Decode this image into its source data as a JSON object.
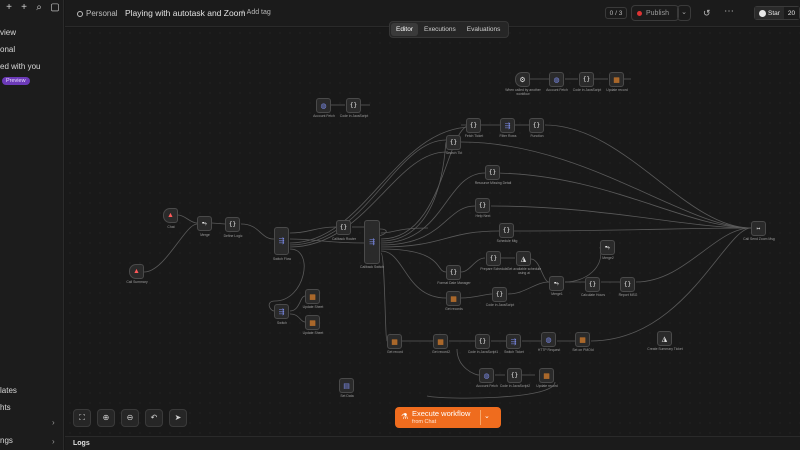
{
  "sidebar": {
    "items": [
      {
        "label": "view"
      },
      {
        "label": "onal"
      },
      {
        "label": "ed with you"
      }
    ],
    "preview_badge": "Preview",
    "bottom_items": [
      {
        "label": "lates"
      },
      {
        "label": "hts"
      },
      {
        "label": "ngs"
      }
    ]
  },
  "header": {
    "breadcrumb": "Personal",
    "workflow_title": "Playing with autotask and Zoom",
    "add_tag": "+ Add tag",
    "counter": "0 / 3",
    "publish_label": "Publish",
    "github_star_label": "Star",
    "github_star_count": "20"
  },
  "tabs": [
    {
      "label": "Editor",
      "active": true
    },
    {
      "label": "Executions",
      "active": false
    },
    {
      "label": "Evaluations",
      "active": false
    }
  ],
  "nodes": [
    {
      "id": "chat",
      "icon": "trigger-icon",
      "label": "Chat"
    },
    {
      "id": "merge1",
      "icon": "merge-icon",
      "label": "Merge"
    },
    {
      "id": "define-logic",
      "icon": "code-icon",
      "label": "Define Logic"
    },
    {
      "id": "switch1",
      "icon": "switch-icon",
      "label": "Switch Flow"
    },
    {
      "id": "switch2",
      "icon": "switch-icon",
      "label": "Switch"
    },
    {
      "id": "update-a",
      "icon": "table-icon",
      "label": "Update Sheet"
    },
    {
      "id": "update-b",
      "icon": "table-icon",
      "label": "Update Sheet"
    },
    {
      "id": "callback",
      "icon": "code-icon",
      "label": "Callback Router"
    },
    {
      "id": "callback-switch",
      "icon": "switch-icon",
      "label": "Callback Switch"
    },
    {
      "id": "http-a",
      "icon": "globe-icon",
      "label": "Account Fetch"
    },
    {
      "id": "code-js-a",
      "icon": "code-icon",
      "label": "Code in JavaScript"
    },
    {
      "id": "webhook-exec",
      "icon": "ai-icon",
      "label": "When called by another workflow"
    },
    {
      "id": "http-b",
      "icon": "globe-icon",
      "label": "Account Fetch"
    },
    {
      "id": "code-js-b",
      "icon": "code-icon",
      "label": "Code in JavaScript"
    },
    {
      "id": "update-c",
      "icon": "table-icon",
      "label": "Update record"
    },
    {
      "id": "fetch-ticket",
      "icon": "code-icon",
      "label": "Fetch Ticket"
    },
    {
      "id": "filter-rows",
      "icon": "switch-icon",
      "label": "Filter Rows"
    },
    {
      "id": "function",
      "icon": "code-icon",
      "label": "Function"
    },
    {
      "id": "search-tkt",
      "icon": "code-icon",
      "label": "Search Tkt"
    },
    {
      "id": "resource",
      "icon": "code-icon",
      "label": "Resource Missing Detail"
    },
    {
      "id": "help-next",
      "icon": "code-icon",
      "label": "Help Next"
    },
    {
      "id": "schedule",
      "icon": "code-icon",
      "label": "Schedule Mtg"
    },
    {
      "id": "format-mgr",
      "icon": "code-icon",
      "label": "Format Date Manager"
    },
    {
      "id": "prepare",
      "icon": "code-icon",
      "label": "Prepare Schedule"
    },
    {
      "id": "ai-schedule",
      "icon": "ai-icon",
      "label": "Get available schedule using ai"
    },
    {
      "id": "get-zoom",
      "icon": "table-icon",
      "label": "Get records"
    },
    {
      "id": "code-js-c",
      "icon": "code-icon",
      "label": "Code in JavaScript"
    },
    {
      "id": "merge2",
      "icon": "merge-icon",
      "label": "Merge1"
    },
    {
      "id": "calc",
      "icon": "code-icon",
      "label": "Calculate Hours"
    },
    {
      "id": "merge3",
      "icon": "merge-icon",
      "label": "Merge2"
    },
    {
      "id": "report",
      "icon": "code-icon",
      "label": "Report MSG"
    },
    {
      "id": "call-send",
      "icon": "send-icon",
      "label": "Call Send Zoom Msg"
    },
    {
      "id": "get-record",
      "icon": "table-icon",
      "label": "Get record"
    },
    {
      "id": "get-record2",
      "icon": "table-icon",
      "label": "Get record2"
    },
    {
      "id": "code-js-d",
      "icon": "code-icon",
      "label": "Code in JavaScript1"
    },
    {
      "id": "switch-ticket",
      "icon": "switch-icon",
      "label": "Switch Ticket"
    },
    {
      "id": "http-c",
      "icon": "globe-icon",
      "label": "HTTP Request"
    },
    {
      "id": "get-pmid",
      "icon": "table-icon",
      "label": "Set on PMOId"
    },
    {
      "id": "ai-zoom",
      "icon": "ai-icon",
      "label": "Create Summary Ticket"
    },
    {
      "id": "http-d",
      "icon": "globe-icon",
      "label": "Account Fetch"
    },
    {
      "id": "code-js-e",
      "icon": "code-icon",
      "label": "Code in JavaScript2"
    },
    {
      "id": "update-d",
      "icon": "table-icon",
      "label": "Update record"
    },
    {
      "id": "set-data",
      "icon": "doc-icon",
      "label": "Set Data"
    },
    {
      "id": "chat-summary",
      "icon": "trigger-icon",
      "label": "Call Summary"
    }
  ],
  "controls": {
    "fit": "fit-view-icon",
    "zoom_in": "zoom-in-icon",
    "zoom_out": "zoom-out-icon",
    "undo": "undo-icon",
    "select": "pointer-icon"
  },
  "execute": {
    "label": "Execute workflow",
    "sublabel": "from Chat"
  },
  "logs": {
    "label": "Logs"
  },
  "colors": {
    "accent": "#ef6c1e",
    "code_node": "#e6e6e6",
    "table_node": "#f08a2c",
    "http_node": "#7f8ff0",
    "trigger_node": "#ff5a5a"
  }
}
